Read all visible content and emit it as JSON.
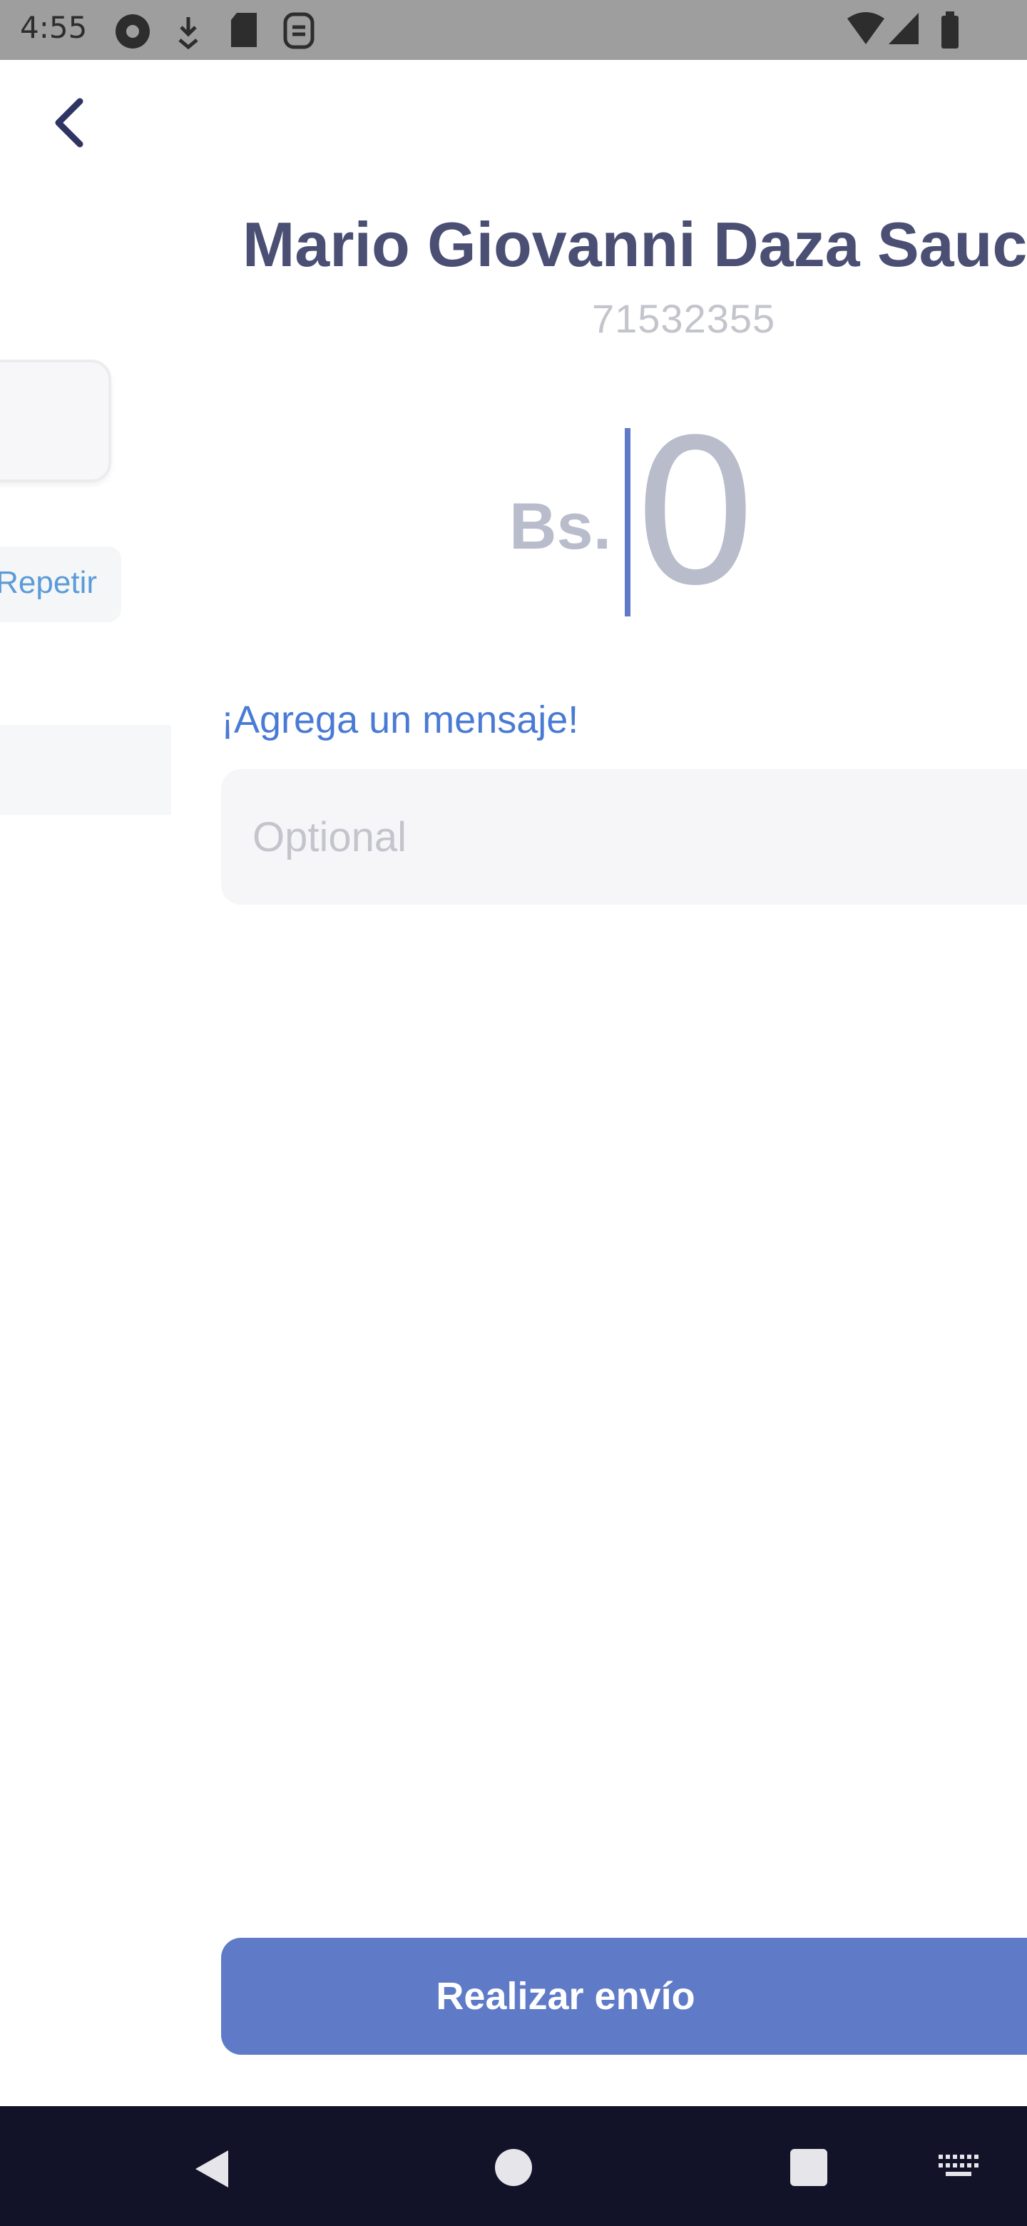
{
  "status_bar": {
    "time": "4:55",
    "left_icons": [
      "chrome-like-icon",
      "download-icon",
      "sd-card-icon",
      "sim-icon"
    ],
    "right_icons": [
      "wifi-icon",
      "signal-icon",
      "battery-icon"
    ]
  },
  "background_screen": {
    "repeat_label": "Repetir"
  },
  "recipient": {
    "name": "Mario Giovanni Daza Sauce",
    "phone": "71532355"
  },
  "amount": {
    "currency": "Bs.",
    "value": "0"
  },
  "message": {
    "label": "¡Agrega un mensaje!",
    "placeholder": "Optional",
    "value": ""
  },
  "submit": {
    "label": "Realizar envío"
  },
  "colors": {
    "primary": "#5f7bc8",
    "title": "#4a4f73",
    "muted": "#b8bccb",
    "nav_bar": "#121229"
  }
}
